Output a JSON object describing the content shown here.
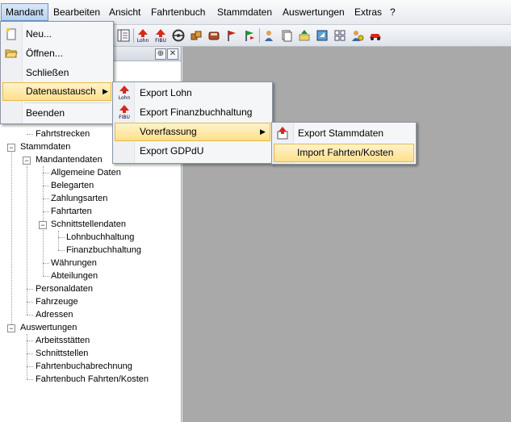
{
  "menubar": {
    "items": [
      "Mandant",
      "Bearbeiten",
      "Ansicht",
      "Fahrtenbuch",
      "Stammdaten",
      "Auswertungen",
      "Extras",
      "?"
    ]
  },
  "toolbar": {
    "icons": [
      "list-icon",
      "lohn-export-icon",
      "fibu-export-icon",
      "steering-wheel-icon",
      "boxes-icon",
      "car-rear-icon",
      "flag-red-icon",
      "flag-green-icon",
      "person-icon",
      "documents-icon",
      "upload-icon",
      "transfer-icon",
      "grid-icon",
      "person-money-icon",
      "car-red-icon"
    ]
  },
  "menus": {
    "mandant": {
      "items": [
        "Neu...",
        "Öffnen...",
        "Schließen",
        "Datenaustausch",
        "Beenden"
      ],
      "active": "Datenaustausch"
    },
    "datenaustausch": {
      "items": [
        "Export Lohn",
        "Export Finanzbuchhaltung",
        "Vorerfassung",
        "Export GDPdU"
      ],
      "active": "Vorerfassung",
      "icon_lohn": "Lohn",
      "icon_fibu": "FIBU"
    },
    "vorerfassung": {
      "items": [
        "Export Stammdaten",
        "Import Fahrten/Kosten"
      ],
      "active": "Import Fahrten/Kosten"
    }
  },
  "tree": {
    "partial_top": "Fahrtstrecken",
    "stammdaten": "Stammdaten",
    "mandantendaten": "Mandantendaten",
    "allgemeine_daten": "Allgemeine Daten",
    "belegarten": "Belegarten",
    "zahlungsarten": "Zahlungsarten",
    "fahrtarten": "Fahrtarten",
    "schnittstellendaten": "Schnittstellendaten",
    "lohnbuchhaltung": "Lohnbuchhaltung",
    "finanzbuchhaltung": "Finanzbuchhaltung",
    "waehrungen": "Währungen",
    "abteilungen": "Abteilungen",
    "personaldaten": "Personaldaten",
    "fahrzeuge": "Fahrzeuge",
    "adressen": "Adressen",
    "auswertungen": "Auswertungen",
    "arbeitsstaetten": "Arbeitsstätten",
    "schnittstellen": "Schnittstellen",
    "fahrtenbuchabrechnung": "Fahrtenbuchabrechnung",
    "fahrtenbuch_fahrten_kosten": "Fahrtenbuch Fahrten/Kosten"
  },
  "colors": {
    "highlight": "#ffe08a",
    "mdi_background": "#a9a9a9"
  }
}
